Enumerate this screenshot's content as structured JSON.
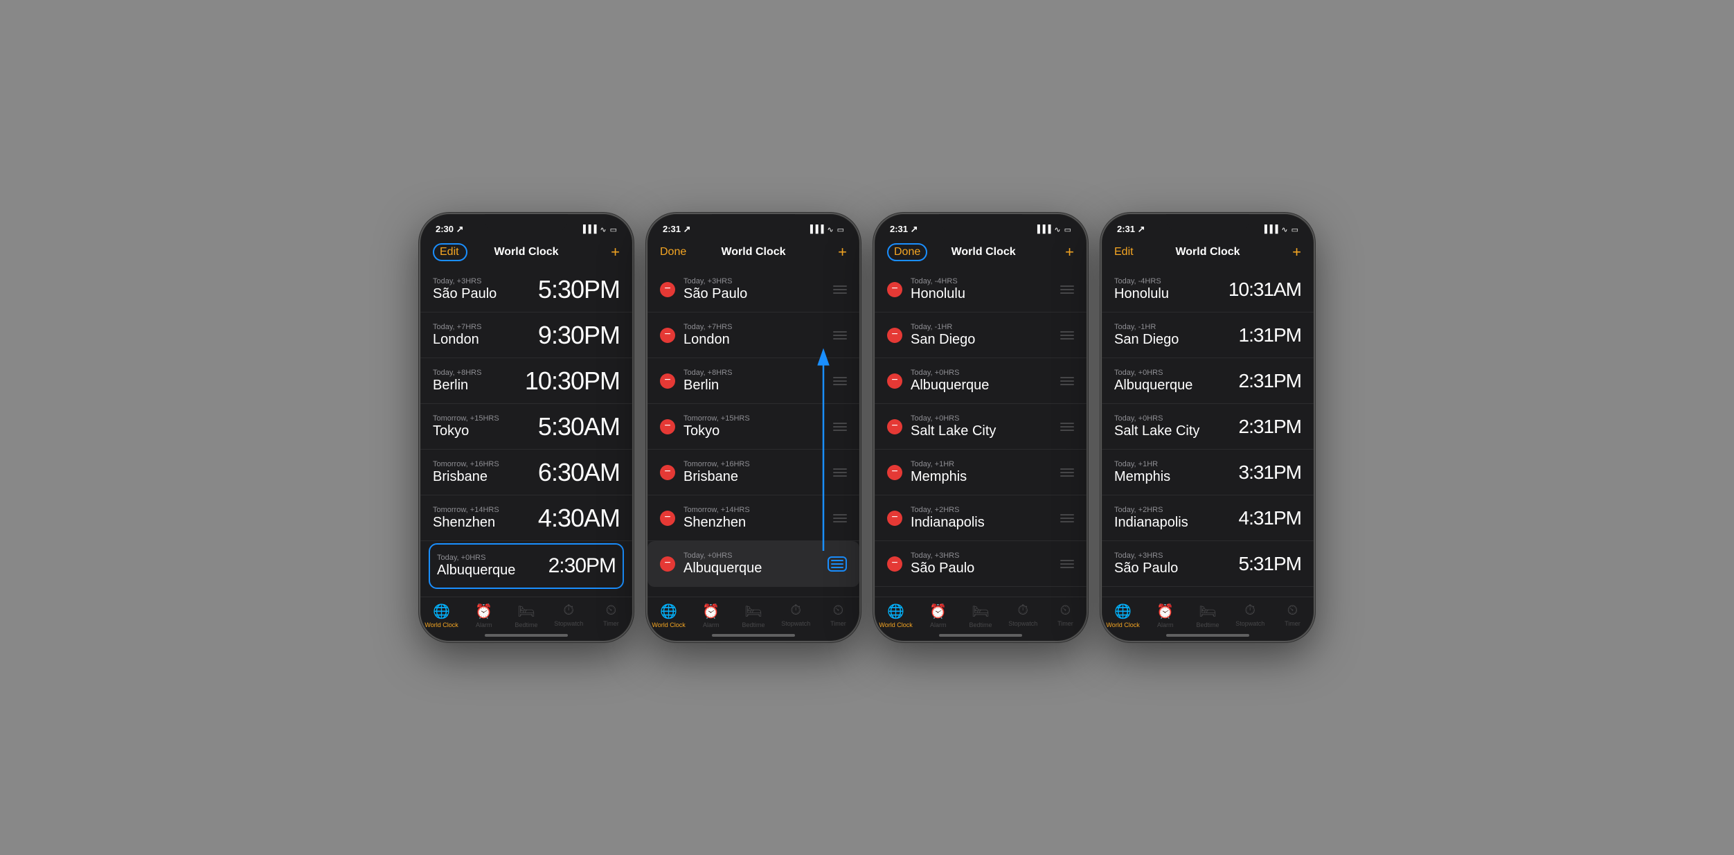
{
  "phones": [
    {
      "id": "phone1",
      "statusBar": {
        "time": "2:30",
        "hasArrow": true
      },
      "nav": {
        "left": "Edit",
        "leftCircled": true,
        "title": "World Clock",
        "right": "+"
      },
      "items": [
        {
          "label": "Today, +3HRS",
          "city": "São Paulo",
          "time": "5:30PM",
          "showDelete": false,
          "showHandle": false,
          "highlighted": false
        },
        {
          "label": "Today, +7HRS",
          "city": "London",
          "time": "9:30PM",
          "showDelete": false,
          "showHandle": false,
          "highlighted": false
        },
        {
          "label": "Today, +8HRS",
          "city": "Berlin",
          "time": "10:30PM",
          "showDelete": false,
          "showHandle": false,
          "highlighted": false
        },
        {
          "label": "Tomorrow, +15HRS",
          "city": "Tokyo",
          "time": "5:30AM",
          "showDelete": false,
          "showHandle": false,
          "highlighted": false
        },
        {
          "label": "Tomorrow, +16HRS",
          "city": "Brisbane",
          "time": "6:30AM",
          "showDelete": false,
          "showHandle": false,
          "highlighted": false
        },
        {
          "label": "Tomorrow, +14HRS",
          "city": "Shenzhen",
          "time": "4:30AM",
          "showDelete": false,
          "showHandle": false,
          "highlighted": false
        },
        {
          "label": "Today, +0HRS",
          "city": "Albuquerque",
          "time": "2:30PM",
          "showDelete": false,
          "showHandle": false,
          "highlighted": true
        }
      ],
      "tabs": [
        {
          "icon": "🌐",
          "label": "World Clock",
          "active": true
        },
        {
          "icon": "⏰",
          "label": "Alarm",
          "active": false
        },
        {
          "icon": "🛏",
          "label": "Bedtime",
          "active": false
        },
        {
          "icon": "⏱",
          "label": "Stopwatch",
          "active": false
        },
        {
          "icon": "⏲",
          "label": "Timer",
          "active": false
        }
      ]
    },
    {
      "id": "phone2",
      "statusBar": {
        "time": "2:31",
        "hasArrow": true
      },
      "nav": {
        "left": "Done",
        "leftCircled": false,
        "title": "World Clock",
        "right": "+"
      },
      "items": [
        {
          "label": "Today, +3HRS",
          "city": "São Paulo",
          "time": "",
          "showDelete": true,
          "showHandle": true,
          "highlighted": false
        },
        {
          "label": "Today, +7HRS",
          "city": "London",
          "time": "",
          "showDelete": true,
          "showHandle": true,
          "highlighted": false
        },
        {
          "label": "Today, +8HRS",
          "city": "Berlin",
          "time": "",
          "showDelete": true,
          "showHandle": true,
          "highlighted": false
        },
        {
          "label": "Tomorrow, +15HRS",
          "city": "Tokyo",
          "time": "",
          "showDelete": true,
          "showHandle": true,
          "highlighted": false
        },
        {
          "label": "Tomorrow, +16HRS",
          "city": "Brisbane",
          "time": "",
          "showDelete": true,
          "showHandle": true,
          "highlighted": false
        },
        {
          "label": "Tomorrow, +14HRS",
          "city": "Shenzhen",
          "time": "",
          "showDelete": true,
          "showHandle": true,
          "highlighted": false
        },
        {
          "label": "Today, +0HRS",
          "city": "Albuquerque",
          "time": "",
          "showDelete": true,
          "showHandle": true,
          "highlighted": false,
          "handleActive": true
        }
      ],
      "tabs": [
        {
          "icon": "🌐",
          "label": "World Clock",
          "active": true
        },
        {
          "icon": "⏰",
          "label": "Alarm",
          "active": false
        },
        {
          "icon": "🛏",
          "label": "Bedtime",
          "active": false
        },
        {
          "icon": "⏱",
          "label": "Stopwatch",
          "active": false
        },
        {
          "icon": "⏲",
          "label": "Timer",
          "active": false
        }
      ]
    },
    {
      "id": "phone3",
      "statusBar": {
        "time": "2:31",
        "hasArrow": true
      },
      "nav": {
        "left": "Done",
        "leftCircled": true,
        "title": "World Clock",
        "right": "+"
      },
      "items": [
        {
          "label": "Today, -4HRS",
          "city": "Honolulu",
          "time": "",
          "showDelete": true,
          "showHandle": true,
          "highlighted": false
        },
        {
          "label": "Today, -1HR",
          "city": "San Diego",
          "time": "",
          "showDelete": true,
          "showHandle": true,
          "highlighted": false
        },
        {
          "label": "Today, +0HRS",
          "city": "Albuquerque",
          "time": "",
          "showDelete": true,
          "showHandle": true,
          "highlighted": false
        },
        {
          "label": "Today, +0HRS",
          "city": "Salt Lake City",
          "time": "",
          "showDelete": true,
          "showHandle": true,
          "highlighted": false
        },
        {
          "label": "Today, +1HR",
          "city": "Memphis",
          "time": "",
          "showDelete": true,
          "showHandle": true,
          "highlighted": false
        },
        {
          "label": "Today, +2HRS",
          "city": "Indianapolis",
          "time": "",
          "showDelete": true,
          "showHandle": true,
          "highlighted": false
        },
        {
          "label": "Today, +3HRS",
          "city": "São Paulo",
          "time": "",
          "showDelete": true,
          "showHandle": true,
          "highlighted": false
        }
      ],
      "tabs": [
        {
          "icon": "🌐",
          "label": "World Clock",
          "active": true
        },
        {
          "icon": "⏰",
          "label": "Alarm",
          "active": false
        },
        {
          "icon": "🛏",
          "label": "Bedtime",
          "active": false
        },
        {
          "icon": "⏱",
          "label": "Stopwatch",
          "active": false
        },
        {
          "icon": "⏲",
          "label": "Timer",
          "active": false
        }
      ]
    },
    {
      "id": "phone4",
      "statusBar": {
        "time": "2:31",
        "hasArrow": true
      },
      "nav": {
        "left": "Edit",
        "leftCircled": false,
        "title": "World Clock",
        "right": "+"
      },
      "items": [
        {
          "label": "Today, -4HRS",
          "city": "Honolulu",
          "time": "10:31AM",
          "showDelete": false,
          "showHandle": false,
          "highlighted": false
        },
        {
          "label": "Today, -1HR",
          "city": "San Diego",
          "time": "1:31PM",
          "showDelete": false,
          "showHandle": false,
          "highlighted": false
        },
        {
          "label": "Today, +0HRS",
          "city": "Albuquerque",
          "time": "2:31PM",
          "showDelete": false,
          "showHandle": false,
          "highlighted": false
        },
        {
          "label": "Today, +0HRS",
          "city": "Salt Lake City",
          "time": "2:31PM",
          "showDelete": false,
          "showHandle": false,
          "highlighted": false
        },
        {
          "label": "Today, +1HR",
          "city": "Memphis",
          "time": "3:31PM",
          "showDelete": false,
          "showHandle": false,
          "highlighted": false
        },
        {
          "label": "Today, +2HRS",
          "city": "Indianapolis",
          "time": "4:31PM",
          "showDelete": false,
          "showHandle": false,
          "highlighted": false
        },
        {
          "label": "Today, +3HRS",
          "city": "São Paulo",
          "time": "5:31PM",
          "showDelete": false,
          "showHandle": false,
          "highlighted": false
        }
      ],
      "tabs": [
        {
          "icon": "🌐",
          "label": "World Clock",
          "active": true
        },
        {
          "icon": "⏰",
          "label": "Alarm",
          "active": false
        },
        {
          "icon": "🛏",
          "label": "Bedtime",
          "active": false
        },
        {
          "icon": "⏱",
          "label": "Stopwatch",
          "active": false
        },
        {
          "icon": "⏲",
          "label": "Timer",
          "active": false
        }
      ]
    }
  ]
}
